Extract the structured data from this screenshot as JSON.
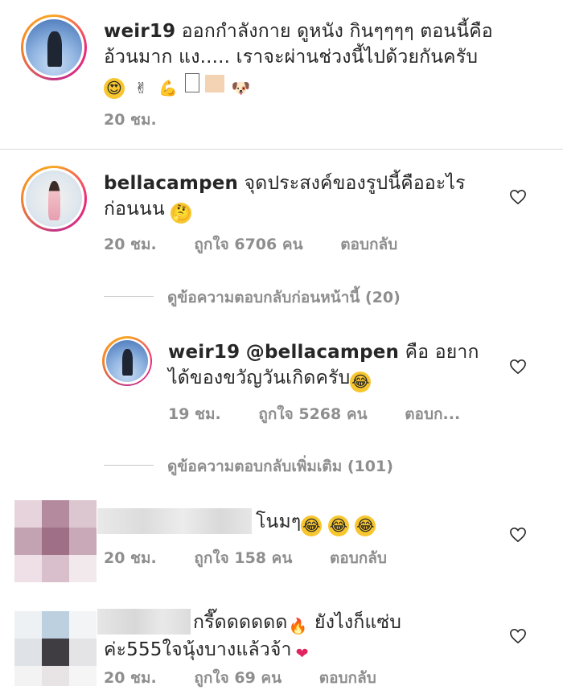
{
  "post": {
    "username": "weir19",
    "caption_line1": "ออกกำลังกาย ดูหนัง กินๆๆๆๆ ตอนนี้คือ",
    "caption_line2": "อ้วนมาก แง..... เราจะผ่านช่วงนี้ไปด้วยกันครับ",
    "emoji_names": [
      "heart-eyes-icon",
      "victory-hand-icon",
      "flexed-biceps-icon",
      "unknown-glyph-icon",
      "skin-tone-swatch-icon",
      "dog-face-icon"
    ],
    "time": "20 ชม."
  },
  "comments": [
    {
      "username": "bellacampen",
      "text_line1": "จุดประสงค์ของรูปนี้คืออะไร",
      "text_line2": "ก่อนนน",
      "emoji_names": [
        "thinking-face-icon"
      ],
      "time": "20 ชม.",
      "likes": "ถูกใจ 6706 คน",
      "reply": "ตอบกลับ"
    },
    {
      "username": "weir19",
      "mention": "@bellacampen",
      "text_line1": " คือ อยาก",
      "text_line2": "ได้ของขวัญวันเกิดครับ",
      "emoji_names": [
        "tears-of-joy-icon"
      ],
      "time": "19 ชม.",
      "likes": "ถูกใจ 5268 คน",
      "reply": "ตอบก..."
    },
    {
      "text_line1": "โนมๆ",
      "emoji_names": [
        "tears-of-joy-icon",
        "tears-of-joy-icon",
        "tears-of-joy-icon"
      ],
      "time": "20 ชม.",
      "likes": "ถูกใจ 158 คน",
      "reply": "ตอบกลับ"
    },
    {
      "text_line1": "กรี๊ดดดดดด",
      "text_line1b": " ยังไงก็แซ่บ",
      "text_line2": "ค่ะ555ใจนุ้งบางแล้วจ้า",
      "emoji_names": [
        "fire-icon",
        "red-heart-icon"
      ],
      "time": "20 ชม.",
      "likes": "ถูกใจ 69 คน",
      "reply": "ตอบกลับ"
    }
  ],
  "view_previous_replies": "ดูข้อความตอบกลับก่อนหน้านี้ (20)",
  "view_more_replies": "ดูข้อความตอบกลับเพิ่มเติม (101)",
  "colors": {
    "text": "#262626",
    "meta": "#8e8e8e",
    "divider": "#dbdbdb",
    "story_ring_start": "#f9a826",
    "story_ring_end": "#c13584"
  }
}
